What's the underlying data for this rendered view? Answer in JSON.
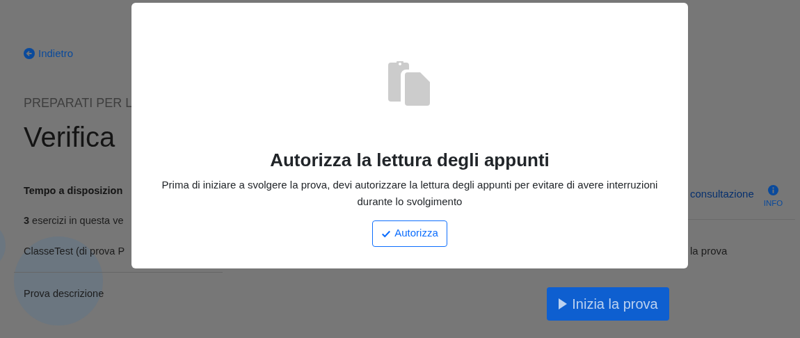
{
  "page": {
    "back_link": "Indietro",
    "eyebrow": "PREPARATI PER L",
    "title": "Verifica",
    "details": [
      {
        "kind": "bold",
        "text": "Tempo a disposizion"
      },
      {
        "kind": "text",
        "text": "**3** esercizi in questa ve"
      },
      {
        "kind": "text",
        "text": "ClasseTest (di prova P"
      },
      {
        "kind": "divider"
      },
      {
        "kind": "text",
        "text": "Prova descrizione"
      }
    ],
    "side_link": "consultazione",
    "info_label": "INFO",
    "side_text": "la prova",
    "start_button": "Inizia la prova"
  },
  "dialog": {
    "title": "Autorizza la lettura degli appunti",
    "message": "Prima di iniziare a svolgere la prova, devi autorizzare la lettura degli appunti per evitare di avere interruzioni durante lo svolgimento",
    "button": "Autorizza"
  }
}
